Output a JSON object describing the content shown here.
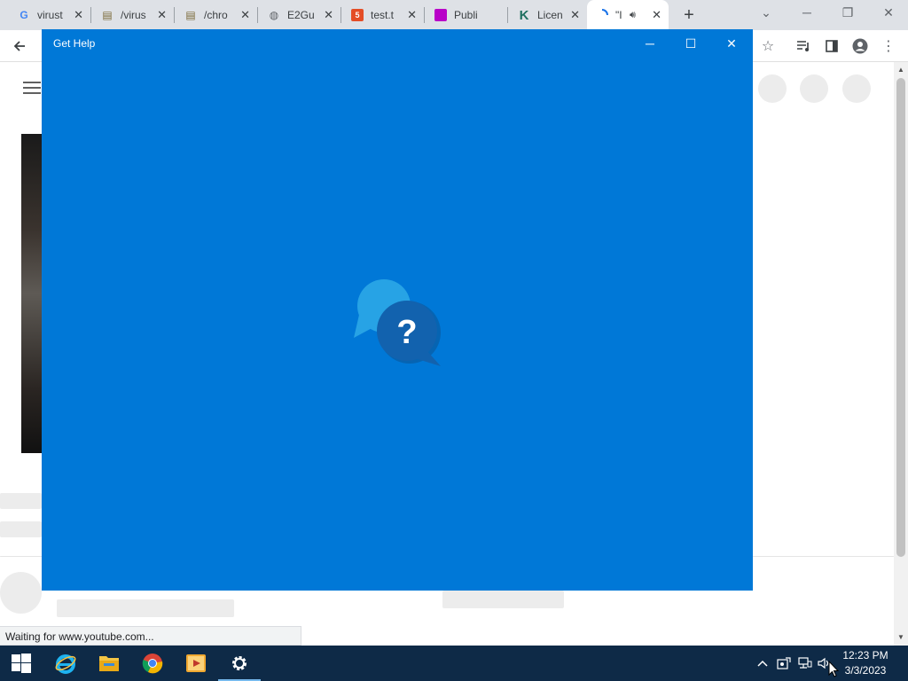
{
  "browser": {
    "tabs": [
      {
        "title": "virust",
        "favicon": "google-g-icon"
      },
      {
        "title": "/virus",
        "favicon": "archive-icon"
      },
      {
        "title": "/chro",
        "favicon": "archive-icon"
      },
      {
        "title": "E2Gu",
        "favicon": "globe-icon"
      },
      {
        "title": "test.t",
        "favicon": "html5-icon"
      },
      {
        "title": "Publi",
        "favicon": "purple-square-icon"
      },
      {
        "title": "Licen",
        "favicon": "k-logo-icon"
      },
      {
        "title": "\"I",
        "favicon": "loading-spinner-icon",
        "audio": "speaker-icon"
      }
    ],
    "new_tab": "+",
    "status_text": "Waiting for www.youtube.com..."
  },
  "help_window": {
    "title": "Get Help",
    "logo_glyph": "?",
    "background": "#0078d7"
  },
  "taskbar": {
    "clock_time": "12:23 PM",
    "clock_date": "3/3/2023",
    "apps": [
      "windows-start-icon",
      "internet-explorer-icon",
      "file-explorer-icon",
      "chrome-icon",
      "media-player-icon",
      "settings-gear-icon"
    ]
  },
  "colors": {
    "accent": "#0078d7",
    "taskbar": "#0e2a47"
  }
}
